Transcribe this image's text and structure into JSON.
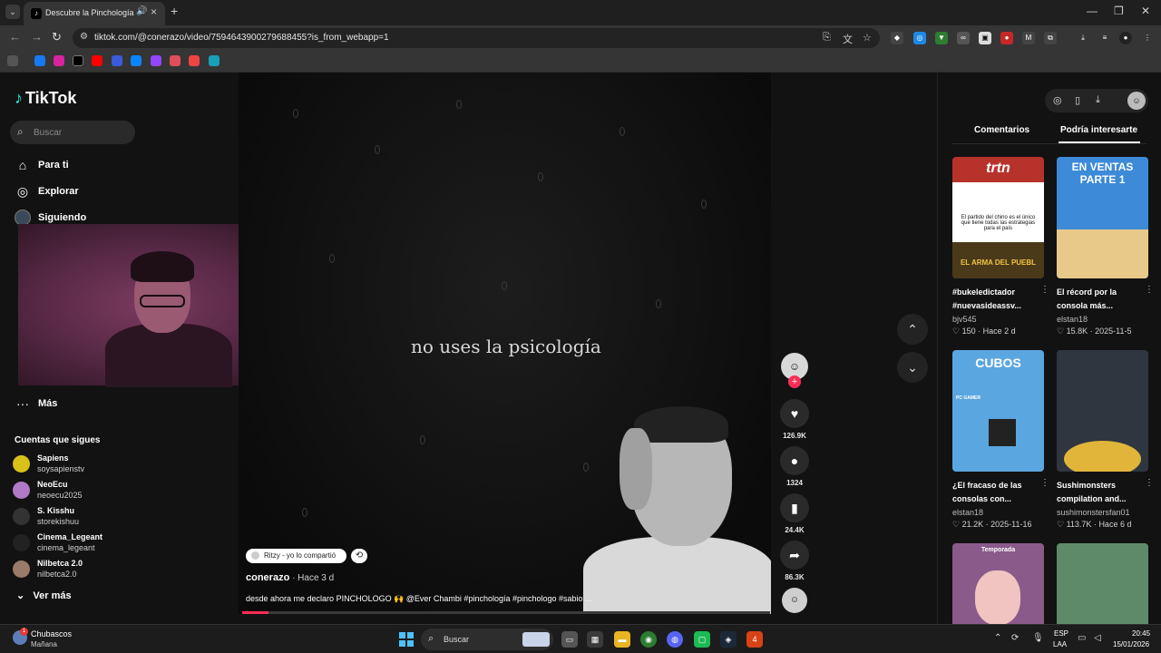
{
  "browser": {
    "tab_title": "Descubre la Pinchología co",
    "url": "tiktok.com/@conerazo/video/7594643900279688455?is_from_webapp=1"
  },
  "sidebar": {
    "logo": "TikTok",
    "search_placeholder": "Buscar",
    "nav": [
      {
        "label": "Para ti",
        "icon": "home-icon"
      },
      {
        "label": "Explorar",
        "icon": "compass-icon"
      },
      {
        "label": "Siguiendo",
        "icon": "following-avatar-icon"
      },
      {
        "label": "Más",
        "icon": "more-dots-icon"
      }
    ],
    "following_title": "Cuentas que sigues",
    "accounts": [
      {
        "name": "Sapiens",
        "handle": "soysapienstv",
        "color": "#d8c21a"
      },
      {
        "name": "NeoEcu",
        "handle": "neoecu2025",
        "color": "#b07ac8"
      },
      {
        "name": "S. Kisshu",
        "handle": "storekishuu",
        "color": "#333333"
      },
      {
        "name": "Cinema_Legeant",
        "handle": "cinema_legeant",
        "color": "#222222"
      },
      {
        "name": "Nilbetca 2.0",
        "handle": "nilbetca2.0",
        "color": "#9a7a6a"
      }
    ],
    "see_more": "Ver más"
  },
  "video": {
    "overlay_text": "no uses la psicología",
    "repost_text": "Ritzy - yo lo compartió",
    "author": "conerazo",
    "posted": " · Hace 3 d",
    "description": "desde ahora me declaro PINCHOLOGO 🙌 @Ever Chambi  #pinchología #pinchologo #sabio ...",
    "progress": 0.05
  },
  "actions": {
    "likes": "126.9K",
    "comments": "1324",
    "saves": "24.4K",
    "shares": "86.3K"
  },
  "right_panel": {
    "tabs": [
      "Comentarios",
      "Podría interesarte"
    ],
    "cards": [
      {
        "thumb_text": "El partido del chino es el único que tiene todas las estrategias para el país",
        "thumb_top": "trtn",
        "thumb_bottom": "EL ARMA DEL PUEBL",
        "title": "#bukeledictador #nuevasideassv...",
        "author": "bjv545",
        "views": "150",
        "date": "Hace 2 d",
        "bg": "#b8322c"
      },
      {
        "thumb_text": "EN VENTAS PARTE 1",
        "title": "El récord por la consola más...",
        "author": "elstan18",
        "views": "15.8K",
        "date": "2025-11-5",
        "bg": "#3c8ad8"
      },
      {
        "thumb_text": "CUBOS",
        "thumb_bottom": "PC GAMER",
        "title": "¿El fracaso de las consolas con...",
        "author": "elstan18",
        "views": "21.2K",
        "date": "2025-11-16",
        "bg": "#5aa6e0"
      },
      {
        "thumb_text": "",
        "title": "Sushimonsters compilation and...",
        "author": "sushimonstersfan01",
        "views": "113.7K",
        "date": "Hace 6 d",
        "bg": "#2f3640"
      },
      {
        "thumb_text": "Temporada",
        "title": "",
        "author": "",
        "views": "",
        "date": "",
        "bg": "#8a5a8a"
      },
      {
        "thumb_text": "",
        "title": "",
        "author": "",
        "views": "",
        "date": "",
        "bg": "#5f8a6a"
      }
    ]
  },
  "taskbar": {
    "weather_title": "Chubascos",
    "weather_sub": "Mañana",
    "weather_badge": "1",
    "search_label": "Buscar",
    "lang_1": "ESP",
    "lang_2": "LAA",
    "time": "20:45",
    "date": "15/01/2026"
  }
}
